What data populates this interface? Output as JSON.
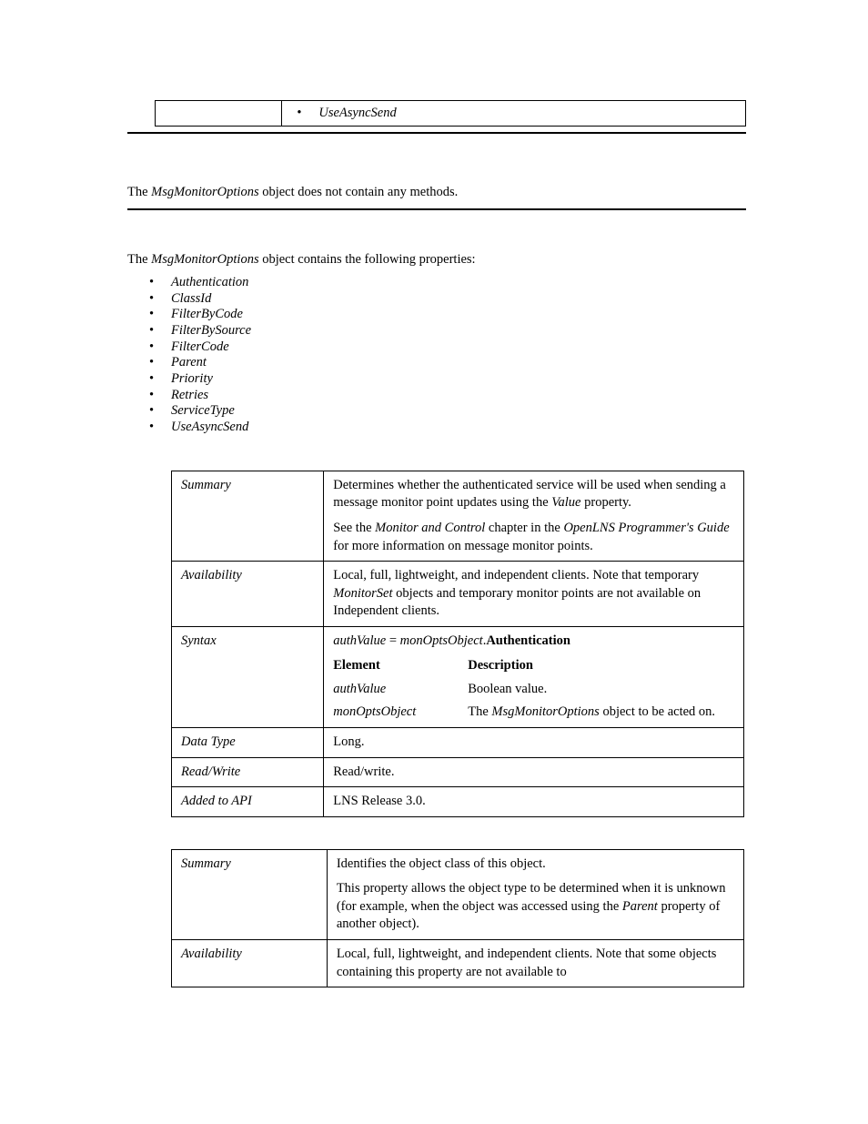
{
  "top_fragment": {
    "item": "UseAsyncSend"
  },
  "methods_note": {
    "prefix": "The ",
    "object": "MsgMonitorOptions",
    "suffix": " object does not contain any methods."
  },
  "properties_intro": {
    "prefix": "The ",
    "object": "MsgMonitorOptions",
    "suffix": " object contains the following properties:"
  },
  "properties": [
    "Authentication",
    "ClassId",
    "FilterByCode",
    "FilterBySource",
    "FilterCode",
    "Parent",
    "Priority",
    "Retries",
    "ServiceType",
    "UseAsyncSend"
  ],
  "table1": {
    "summary_label": "Summary",
    "summary_p1a": "Determines whether the authenticated service will be used when sending a message monitor point updates using the ",
    "summary_p1_ital": "Value",
    "summary_p1b": " property.",
    "summary_p2a": "See the ",
    "summary_p2_ital1": "Monitor and Control",
    "summary_p2b": " chapter in the ",
    "summary_p2_ital2": "OpenLNS Programmer's Guide",
    "summary_p2c": " for more information on message monitor points.",
    "availability_label": "Availability",
    "availability_a": "Local, full, lightweight, and independent clients. Note that temporary ",
    "availability_ital": "MonitorSet",
    "availability_b": " objects and temporary monitor points are not available on Independent clients.",
    "syntax_label": "Syntax",
    "syntax_lhs": "authValue",
    "syntax_eq": " = ",
    "syntax_obj": "monOptsObject",
    "syntax_dot": ".",
    "syntax_prop": "Authentication",
    "element_header": "Element",
    "description_header": "Description",
    "elem1_name": "authValue",
    "elem1_desc": "Boolean value.",
    "elem2_name": "monOptsObject",
    "elem2_desc_a": "The ",
    "elem2_desc_ital": "MsgMonitorOptions",
    "elem2_desc_b": " object to be acted on.",
    "datatype_label": "Data Type",
    "datatype_value": "Long.",
    "readwrite_label": "Read/Write",
    "readwrite_value": "Read/write.",
    "added_label": "Added to API",
    "added_value": "LNS Release 3.0."
  },
  "table2": {
    "summary_label": "Summary",
    "summary_p1": "Identifies the object class of this object.",
    "summary_p2a": "This property allows the object type to be determined when it is unknown (for example, when the object was accessed using the ",
    "summary_p2_ital": "Parent",
    "summary_p2b": " property of another object).",
    "availability_label": "Availability",
    "availability_text": "Local, full, lightweight, and independent clients. Note that some objects containing this property are not available to"
  }
}
